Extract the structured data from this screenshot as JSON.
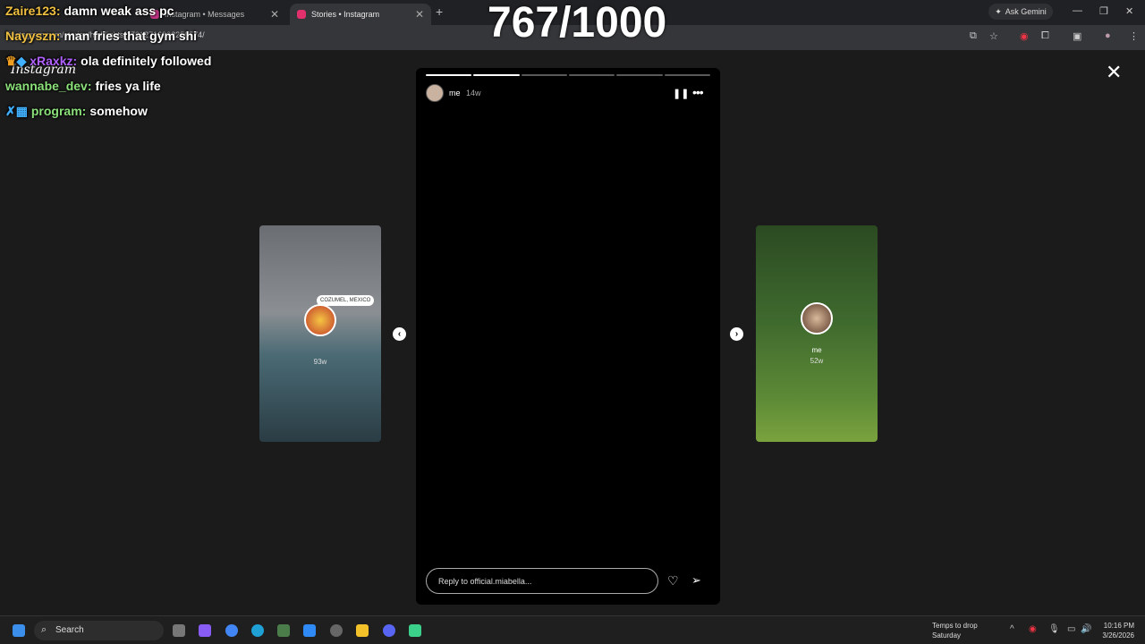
{
  "browser": {
    "tabs": [
      {
        "label": "Instagram • Messages",
        "active": false
      },
      {
        "label": "Stories • Instagram",
        "active": true
      }
    ],
    "new_tab": "+",
    "ask_gemini": "Ask Gemini",
    "url": "instagram.com/stories/highlights/17912716902256574/"
  },
  "instagram": {
    "logo": "Instagram",
    "close": "✕",
    "story": {
      "username": "me",
      "age": "14w",
      "progress_segments": 6,
      "progress_done": 2,
      "reply_placeholder": "Reply to official.miabella..."
    },
    "left_preview": {
      "location": "COZUMEL, MEXICO",
      "age": "93w"
    },
    "right_preview": {
      "username": "me",
      "age": "52w"
    }
  },
  "overlay": {
    "counter": "767/1000",
    "chat": [
      {
        "user": "Zaire123:",
        "msg": "damn weak ass pc",
        "color": "#f0c040"
      },
      {
        "user": "Nayyszn:",
        "msg": "man fries that gym shi",
        "color": "#f0c040"
      },
      {
        "user": "xRaxkz:",
        "msg": "ola definitely followed",
        "color": "#b060ff"
      },
      {
        "user": "wannabe_dev:",
        "msg": "fries ya life",
        "color": "#8be07a"
      },
      {
        "user": "program:",
        "msg": "somehow",
        "color": "#8be07a"
      }
    ]
  },
  "taskbar": {
    "search": "Search",
    "weather_title": "Temps to drop",
    "weather_sub": "Saturday",
    "time": "10:16 PM",
    "date": "3/26/2026"
  },
  "colors": {
    "accent": "#e1306c",
    "page_bg": "#1b1b1b"
  }
}
